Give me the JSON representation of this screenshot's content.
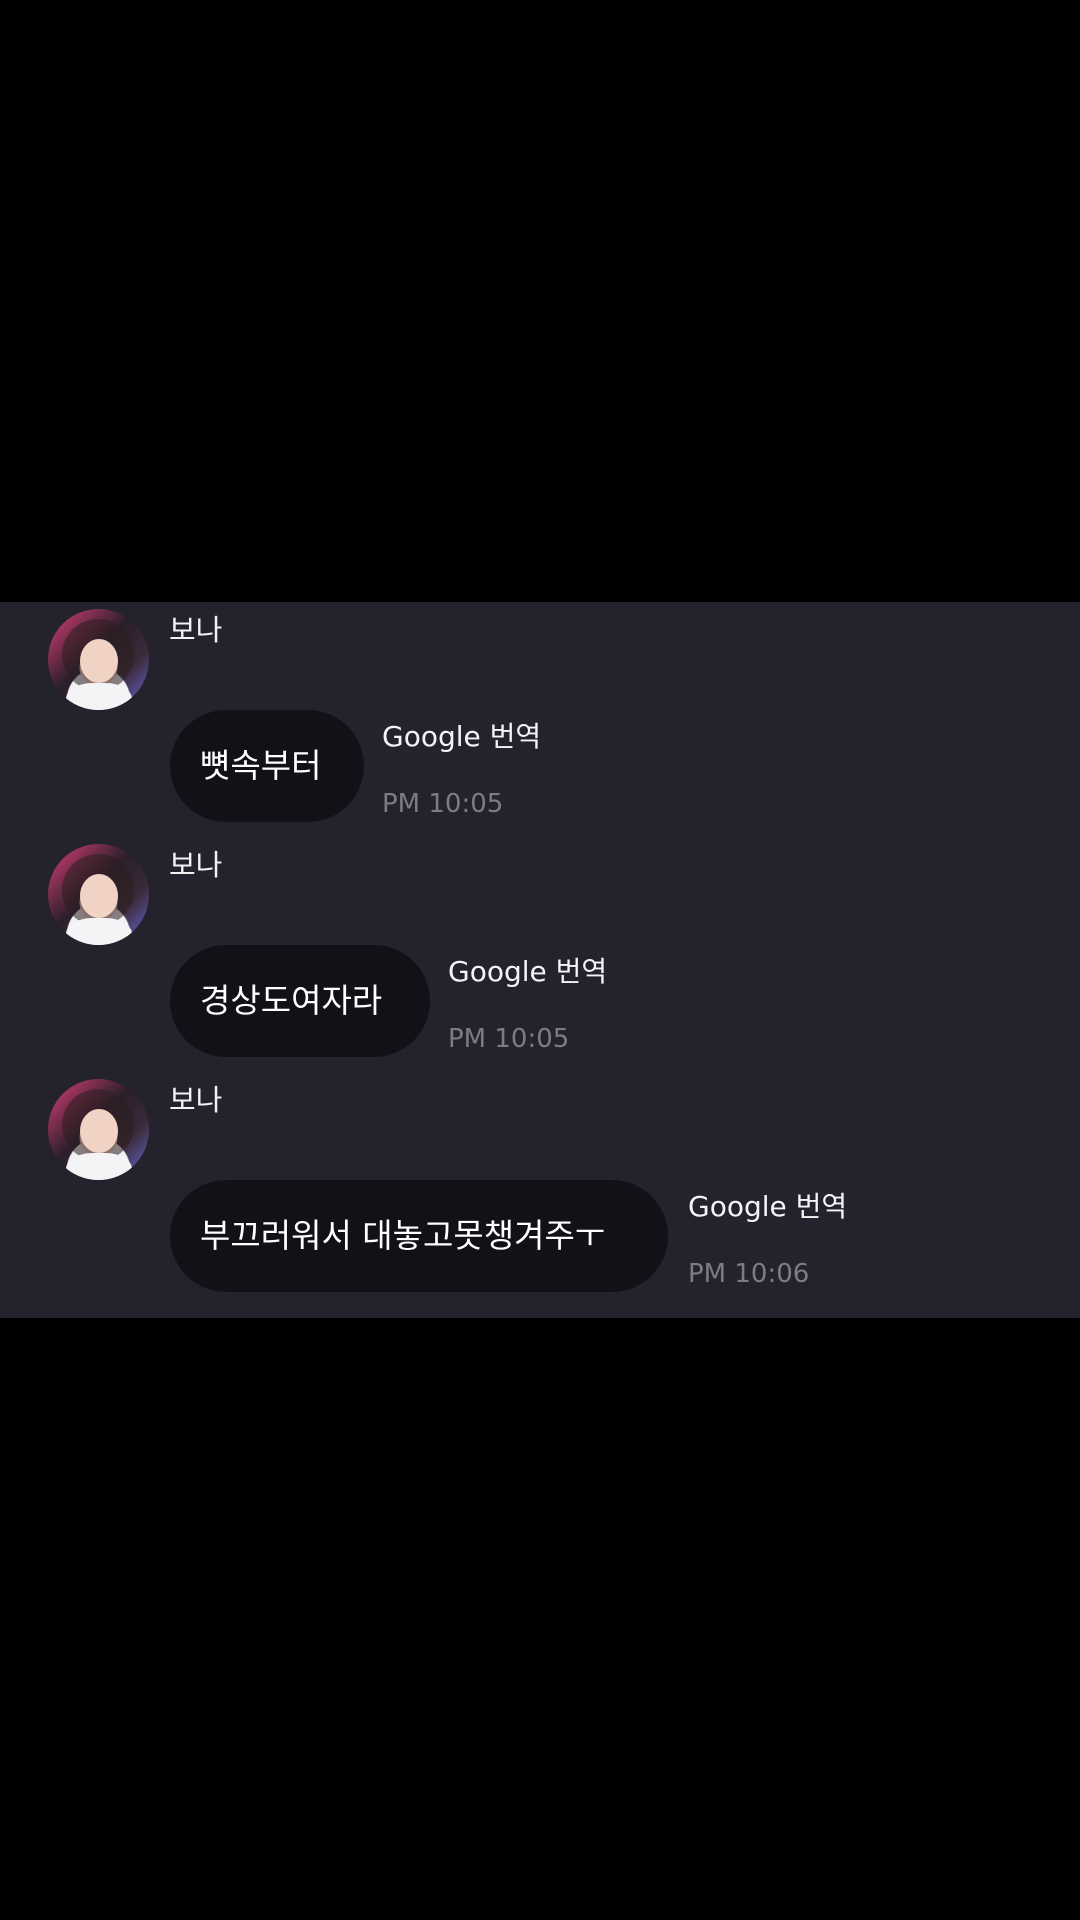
{
  "messages": [
    {
      "sender": "보나",
      "text": "뼛속부터",
      "translate_label": "Google 번역",
      "time": "PM 10:05"
    },
    {
      "sender": "보나",
      "text": "경상도여자라",
      "translate_label": "Google 번역",
      "time": "PM 10:05"
    },
    {
      "sender": "보나",
      "text": "부끄러워서 대놓고못챙겨주ㅜ",
      "translate_label": "Google 번역",
      "time": "PM 10:06"
    }
  ],
  "colors": {
    "page_background": "#000000",
    "chat_background": "#23222d",
    "bubble_background": "#121118",
    "text_primary": "#ffffff",
    "timestamp": "#7d7c86"
  }
}
